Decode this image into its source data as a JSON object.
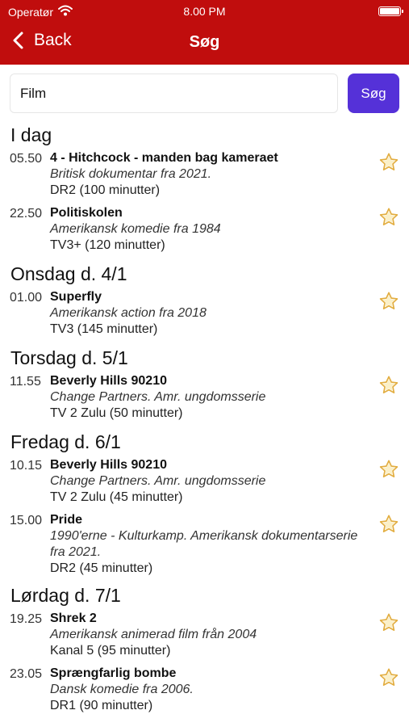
{
  "status_bar": {
    "carrier": "Operatør",
    "time": "8.00 PM"
  },
  "nav": {
    "back_label": "Back",
    "title": "Søg"
  },
  "search": {
    "value": "Film",
    "button_label": "Søg"
  },
  "colors": {
    "header": "#c00d0d",
    "button": "#5531d8",
    "star": "#e8b94a"
  },
  "days": [
    {
      "heading": "I dag",
      "items": [
        {
          "time": "05.50",
          "title": "4 - Hitchcock - manden bag kameraet",
          "description": "Britisk dokumentar fra 2021.",
          "channel": "DR2 (100 minutter)"
        },
        {
          "time": "22.50",
          "title": "Politiskolen",
          "description": "Amerikansk komedie fra 1984",
          "channel": "TV3+ (120 minutter)"
        }
      ]
    },
    {
      "heading": "Onsdag d. 4/1",
      "items": [
        {
          "time": "01.00",
          "title": "Superfly",
          "description": "Amerikansk action fra 2018",
          "channel": "TV3 (145 minutter)"
        }
      ]
    },
    {
      "heading": "Torsdag d. 5/1",
      "items": [
        {
          "time": "11.55",
          "title": "Beverly Hills 90210",
          "description": "Change Partners. Amr. ungdomsserie",
          "channel": "TV 2 Zulu (50 minutter)"
        }
      ]
    },
    {
      "heading": "Fredag d. 6/1",
      "items": [
        {
          "time": "10.15",
          "title": "Beverly Hills 90210",
          "description": "Change Partners. Amr. ungdomsserie",
          "channel": "TV 2 Zulu (45 minutter)"
        },
        {
          "time": "15.00",
          "title": "Pride",
          "description": "1990'erne - Kulturkamp. Amerikansk dokumentarserie fra 2021.",
          "channel": "DR2 (45 minutter)"
        }
      ]
    },
    {
      "heading": "Lørdag d. 7/1",
      "items": [
        {
          "time": "19.25",
          "title": "Shrek 2",
          "description": "Amerikansk animerad film från 2004",
          "channel": "Kanal 5 (95 minutter)"
        },
        {
          "time": "23.05",
          "title": "Sprængfarlig bombe",
          "description": "Dansk komedie fra 2006.",
          "channel": "DR1 (90 minutter)"
        }
      ]
    }
  ]
}
